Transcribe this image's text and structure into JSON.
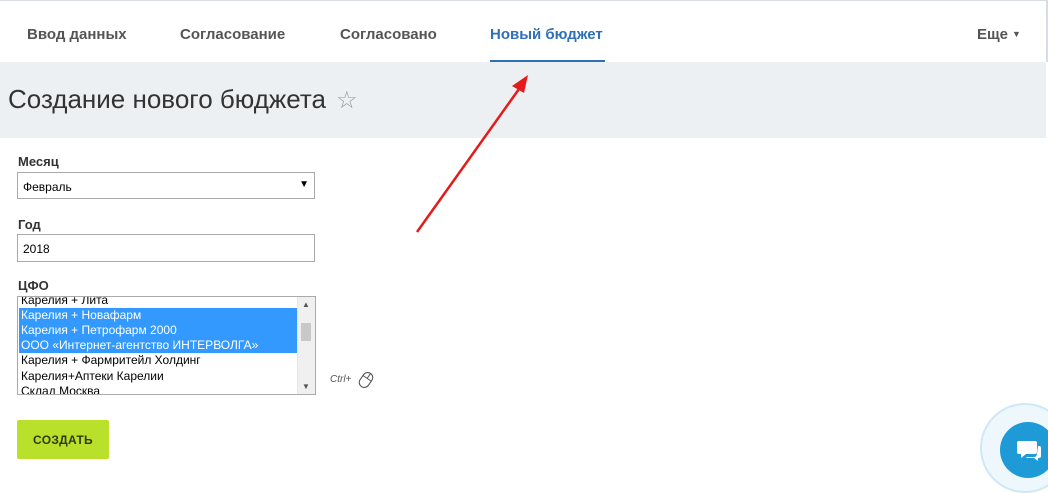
{
  "nav": {
    "tabs": [
      {
        "label": "Ввод данных",
        "active": false
      },
      {
        "label": "Согласование",
        "active": false
      },
      {
        "label": "Согласовано",
        "active": false
      },
      {
        "label": "Новый бюджет",
        "active": true
      }
    ],
    "more_label": "Еще",
    "active_color": "#2f6fb6"
  },
  "page": {
    "title": "Создание нового бюджета",
    "favorite_icon": "star-icon"
  },
  "form": {
    "month": {
      "label": "Месяц",
      "value": "Февраль"
    },
    "year": {
      "label": "Год",
      "value": "2018"
    },
    "cfo": {
      "label": "ЦФО",
      "options": [
        {
          "label": "Карелия + Лита",
          "selected": false
        },
        {
          "label": "Карелия + Новафарм",
          "selected": true
        },
        {
          "label": "Карелия + Петрофарм 2000",
          "selected": true
        },
        {
          "label": "ООО «Интернет-агентство ИНТЕРВОЛГА»",
          "selected": true
        },
        {
          "label": "Карелия + Фармритейл Холдинг",
          "selected": false
        },
        {
          "label": "Карелия+Аптеки Карелии",
          "selected": false
        },
        {
          "label": "Склад Москва",
          "selected": false
        }
      ],
      "multi_select_hint": "Ctrl+",
      "hint_icon": "mouse-icon"
    },
    "submit_label": "СОЗДАТЬ",
    "submit_color": "#b9e02b"
  },
  "chat": {
    "icon": "chat-icon",
    "color": "#1e9ad6"
  }
}
